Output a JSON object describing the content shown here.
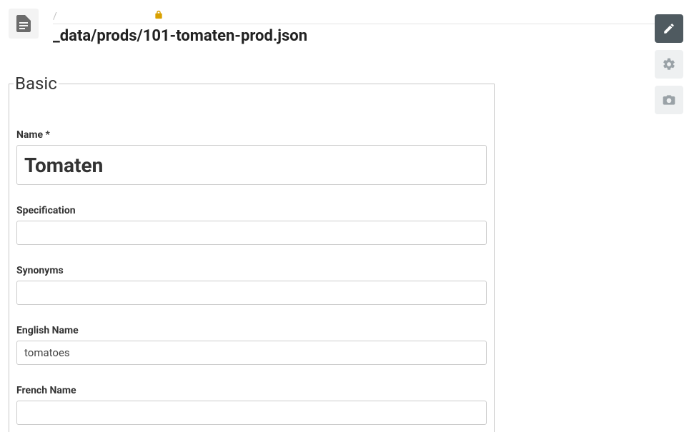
{
  "header": {
    "breadcrumb_sep": "/",
    "file_path": "_data/prods/101-tomaten-prod.json"
  },
  "form": {
    "legend": "Basic",
    "fields": {
      "name": {
        "label": "Name *",
        "value": "Tomaten"
      },
      "specification": {
        "label": "Specification",
        "value": ""
      },
      "synonyms": {
        "label": "Synonyms",
        "value": ""
      },
      "english_name": {
        "label": "English Name",
        "value": "tomatoes"
      },
      "french_name": {
        "label": "French Name",
        "value": ""
      }
    }
  },
  "icons": {
    "file": "file-icon",
    "lock": "lock-icon",
    "edit": "pencil-icon",
    "settings": "gear-icon",
    "view": "camera-icon"
  }
}
